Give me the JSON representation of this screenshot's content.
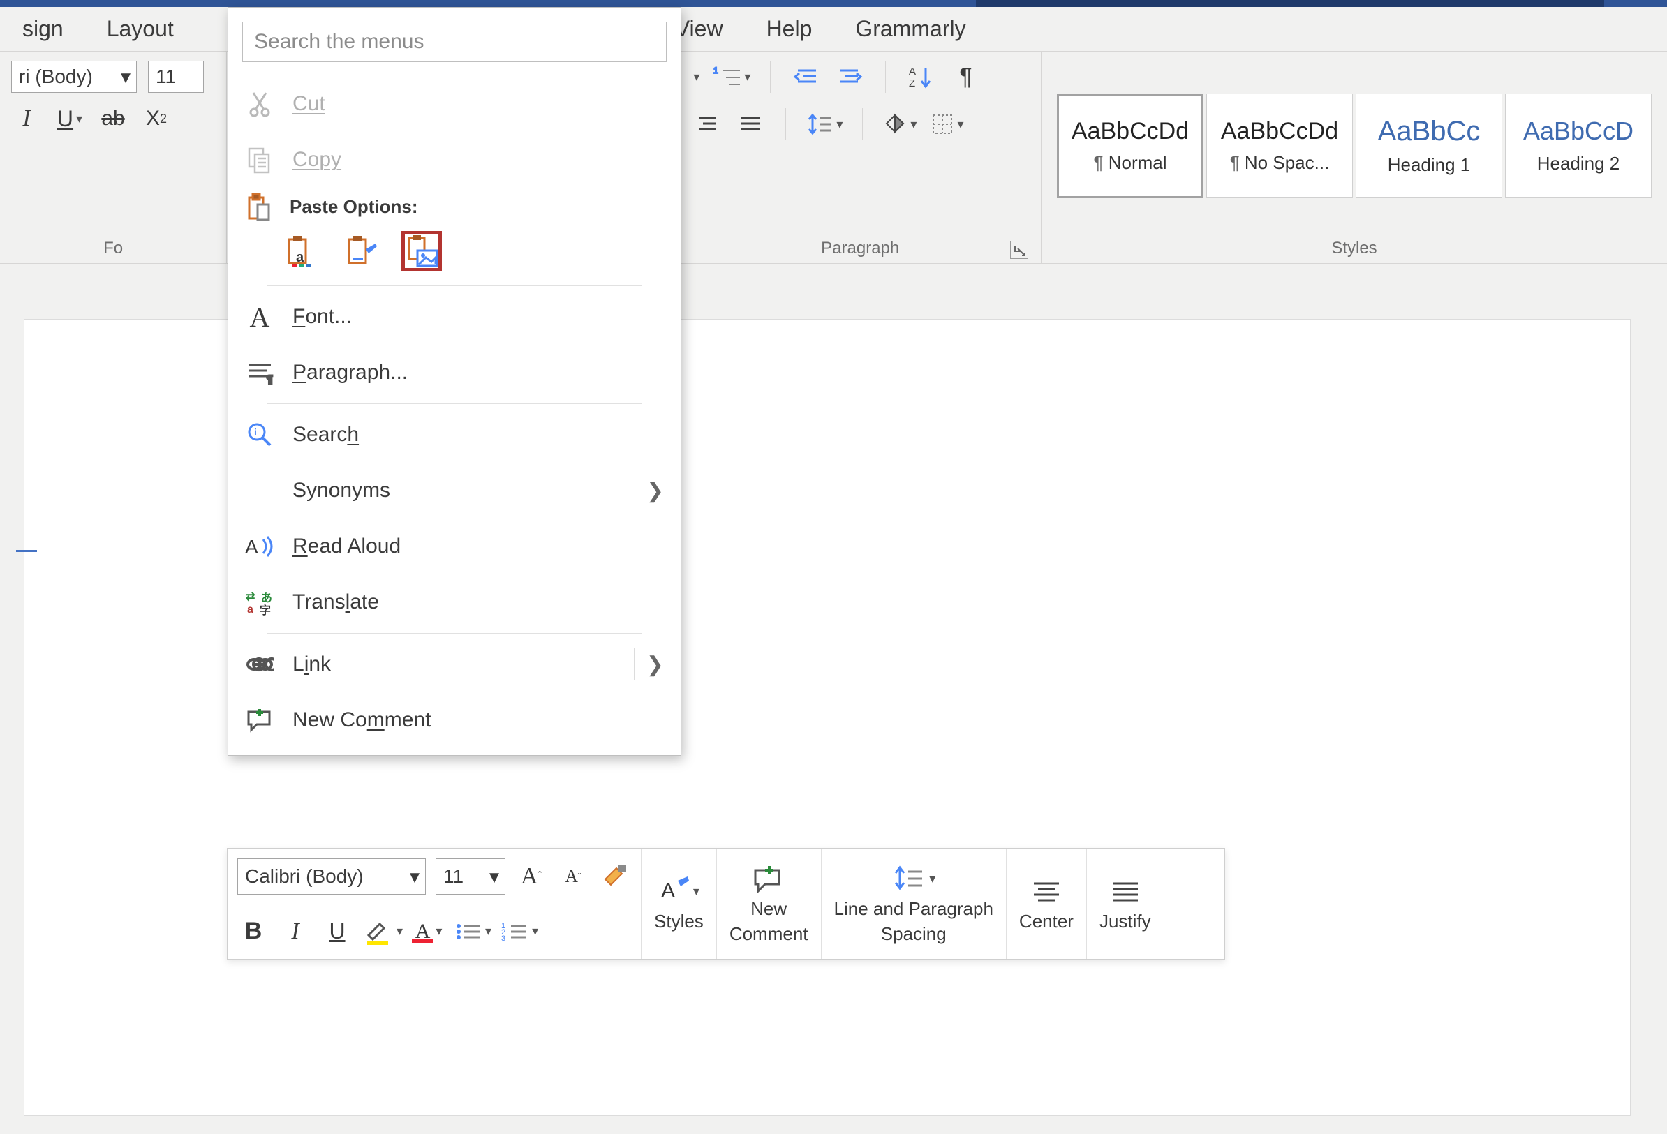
{
  "tabs": {
    "design": "sign",
    "layout": "Layout",
    "view": "View",
    "help": "Help",
    "grammarly": "Grammarly"
  },
  "font_group": {
    "font_name": "ri (Body)",
    "font_size": "11",
    "label": "Fo"
  },
  "paragraph_group": {
    "label": "Paragraph"
  },
  "styles_group": {
    "label": "Styles",
    "items": [
      {
        "sample": "AaBbCcDd",
        "name": "Normal",
        "selected": true
      },
      {
        "sample": "AaBbCcDd",
        "name": "No Spac..."
      },
      {
        "sample": "AaBbCc",
        "name": "Heading 1",
        "blue": true
      },
      {
        "sample": "AaBbCcD",
        "name": "Heading 2",
        "blue": true
      }
    ]
  },
  "context_menu": {
    "search_placeholder": "Search the menus",
    "cut": "Cut",
    "copy": "Copy",
    "paste_options": "Paste Options:",
    "font": "Font...",
    "paragraph": "Paragraph...",
    "search": "Search",
    "synonyms": "Synonyms",
    "read_aloud": "Read Aloud",
    "translate": "Translate",
    "link": "Link",
    "new_comment": "New Comment"
  },
  "mini_toolbar": {
    "font_name": "Calibri (Body)",
    "font_size": "11",
    "styles": "Styles",
    "new_comment_line1": "New",
    "new_comment_line2": "Comment",
    "spacing_line1": "Line and Paragraph",
    "spacing_line2": "Spacing",
    "center": "Center",
    "justify": "Justify"
  }
}
